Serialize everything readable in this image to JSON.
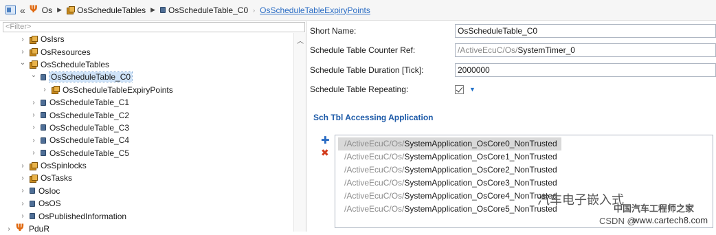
{
  "breadcrumb": {
    "items": [
      "Os",
      "OsScheduleTables",
      "OsScheduleTable_C0",
      "OsScheduleTableExpiryPoints"
    ]
  },
  "filter": {
    "placeholder": "<Filter>"
  },
  "tree": {
    "rows": [
      {
        "label": "OsIsrs",
        "expanded": false,
        "icon": "package-cube-icon"
      },
      {
        "label": "OsResources",
        "expanded": false,
        "icon": "package-cube-icon"
      },
      {
        "label": "OsScheduleTables",
        "expanded": true,
        "icon": "package-cube-icon"
      },
      {
        "label": "OsScheduleTable_C0",
        "expanded": true,
        "selected": true,
        "icon": "node-icon"
      },
      {
        "label": "OsScheduleTableExpiryPoints",
        "expanded": false,
        "icon": "package-cube-icon"
      },
      {
        "label": "OsScheduleTable_C1",
        "expanded": false,
        "icon": "node-icon"
      },
      {
        "label": "OsScheduleTable_C2",
        "expanded": false,
        "icon": "node-icon"
      },
      {
        "label": "OsScheduleTable_C3",
        "expanded": false,
        "icon": "node-icon"
      },
      {
        "label": "OsScheduleTable_C4",
        "expanded": false,
        "icon": "node-icon"
      },
      {
        "label": "OsScheduleTable_C5",
        "expanded": false,
        "icon": "node-icon"
      },
      {
        "label": "OsSpinlocks",
        "expanded": false,
        "icon": "package-cube-icon"
      },
      {
        "label": "OsTasks",
        "expanded": false,
        "icon": "package-cube-icon"
      },
      {
        "label": "OsIoc",
        "expanded": false,
        "icon": "node-icon"
      },
      {
        "label": "OsOS",
        "expanded": false,
        "icon": "node-icon"
      },
      {
        "label": "OsPublishedInformation",
        "expanded": false,
        "icon": "node-icon"
      },
      {
        "label": "PduR",
        "expanded": false,
        "icon": "fork-icon"
      }
    ]
  },
  "form": {
    "short_name": {
      "label": "Short Name:",
      "value": "OsScheduleTable_C0"
    },
    "counter_ref": {
      "label": "Schedule Table Counter Ref:",
      "prefix": "/ActiveEcuC/Os/",
      "value": "SystemTimer_0"
    },
    "duration": {
      "label": "Schedule Table Duration [Tick]:",
      "value": "2000000"
    },
    "repeating": {
      "label": "Schedule Table Repeating:",
      "checked": true
    }
  },
  "accessing": {
    "title": "Sch Tbl Accessing Application",
    "items": [
      {
        "prefix": "/ActiveEcuC/Os/",
        "name": "SystemApplication_OsCore0_NonTrusted"
      },
      {
        "prefix": "/ActiveEcuC/Os/",
        "name": "SystemApplication_OsCore1_NonTrusted"
      },
      {
        "prefix": "/ActiveEcuC/Os/",
        "name": "SystemApplication_OsCore2_NonTrusted"
      },
      {
        "prefix": "/ActiveEcuC/Os/",
        "name": "SystemApplication_OsCore3_NonTrusted"
      },
      {
        "prefix": "/ActiveEcuC/Os/",
        "name": "SystemApplication_OsCore4_NonTrusted"
      },
      {
        "prefix": "/ActiveEcuC/Os/",
        "name": "SystemApplication_OsCore5_NonTrusted"
      }
    ]
  },
  "watermark": {
    "line1": "汽车电子嵌入式",
    "line2": "中国汽车工程师之家",
    "line3": "CSDN @",
    "line4": "www.cartech8.com"
  }
}
